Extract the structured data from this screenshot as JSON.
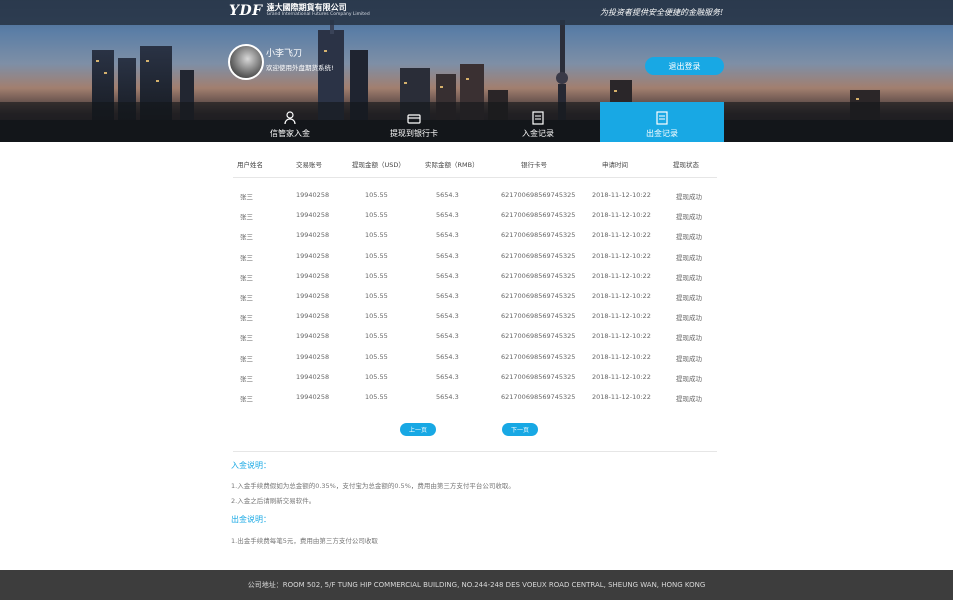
{
  "header": {
    "logo_mark": "YDF",
    "logo_cn": "遠大國際期貨有限公司",
    "logo_en": "Grand International Futures Company Limited",
    "slogan": "为投资者提供安全便捷的金融服务!"
  },
  "user": {
    "name": "小李飞刀",
    "welcome": "欢迎使用外盘期货系统!",
    "logout_label": "退出登录"
  },
  "nav": [
    {
      "label": "信管家入金",
      "icon": "user-icon"
    },
    {
      "label": "提现到银行卡",
      "icon": "card-icon"
    },
    {
      "label": "入金记录",
      "icon": "record-icon"
    },
    {
      "label": "出金记录",
      "icon": "record-icon",
      "active": true
    }
  ],
  "table": {
    "headers": [
      "用户姓名",
      "交易账号",
      "提现金额（USD）",
      "实际金额（RMB）",
      "银行卡号",
      "申请时间",
      "提现状态"
    ],
    "rows": [
      [
        "张三",
        "19940258",
        "105.55",
        "5654.3",
        "6217006985697453​25",
        "2018-11-12-10:22",
        "提现成功"
      ],
      [
        "张三",
        "19940258",
        "105.55",
        "5654.3",
        "621700698569745325",
        "2018-11-12-10:22",
        "提现成功"
      ],
      [
        "张三",
        "19940258",
        "105.55",
        "5654.3",
        "621700698569745325",
        "2018-11-12-10:22",
        "提现成功"
      ],
      [
        "张三",
        "19940258",
        "105.55",
        "5654.3",
        "621700698569745325",
        "2018-11-12-10:22",
        "提现成功"
      ],
      [
        "张三",
        "19940258",
        "105.55",
        "5654.3",
        "621700698569745325",
        "2018-11-12-10:22",
        "提现成功"
      ],
      [
        "张三",
        "19940258",
        "105.55",
        "5654.3",
        "621700698569745325",
        "2018-11-12-10:22",
        "提现成功"
      ],
      [
        "张三",
        "19940258",
        "105.55",
        "5654.3",
        "621700698569745325",
        "2018-11-12-10:22",
        "提现成功"
      ],
      [
        "张三",
        "19940258",
        "105.55",
        "5654.3",
        "621700698569745325",
        "2018-11-12-10:22",
        "提现成功"
      ],
      [
        "张三",
        "19940258",
        "105.55",
        "5654.3",
        "621700698569745325",
        "2018-11-12-10:22",
        "提现成功"
      ],
      [
        "张三",
        "19940258",
        "105.55",
        "5654.3",
        "621700698569745325",
        "2018-11-12-10:22",
        "提现成功"
      ],
      [
        "张三",
        "19940258",
        "105.55",
        "5654.3",
        "621700698569745325",
        "2018-11-12-10:22",
        "提现成功"
      ]
    ]
  },
  "pager": {
    "prev_label": "上一页",
    "next_label": "下一页"
  },
  "notes": {
    "deposit_title": "入金说明：",
    "deposit_lines": [
      "1.入金手续费假如为总金额的0.35%，支付宝为总金额的0.5%，费用由第三方支付平台公司收取。",
      "2.入金之后请刷新交易软件。"
    ],
    "withdraw_title": "出金说明：",
    "withdraw_lines": [
      "1.出金手续费每笔5元，费用由第三方支付公司收取"
    ]
  },
  "footer": {
    "address": "公司地址：ROOM 502, 5/F TUNG HIP COMMERCIAL BUILDING, NO.244-248 DES VOEUX ROAD CENTRAL, SHEUNG WAN, HONG KONG"
  },
  "colors": {
    "accent": "#18a8e4",
    "footer_bg": "#3d3d3d"
  }
}
